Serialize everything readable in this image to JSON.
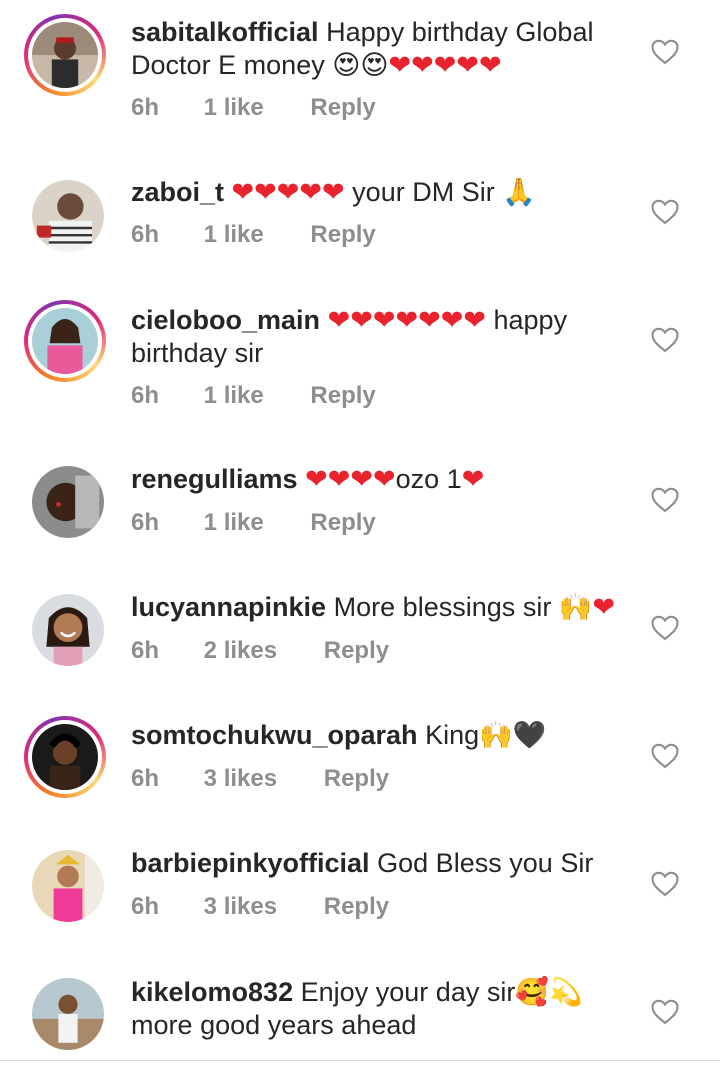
{
  "comments": [
    {
      "username": "sabitalkofficial",
      "text": " Happy birthday Global Doctor E money 😍😍❤️❤️❤️❤️❤️",
      "time": "6h",
      "likes": "1 like",
      "reply": "Reply",
      "has_story_ring": true
    },
    {
      "username": "zaboi_t",
      "text": " ❤️❤️❤️❤️❤️ your DM Sir 🙏",
      "time": "6h",
      "likes": "1 like",
      "reply": "Reply",
      "has_story_ring": false
    },
    {
      "username": "cieloboo_main",
      "text": " ❤️❤️❤️❤️❤️❤️❤️ happy birthday sir",
      "time": "6h",
      "likes": "1 like",
      "reply": "Reply",
      "has_story_ring": true
    },
    {
      "username": "renegulliams",
      "text": " ❤️❤️❤️❤️ozo 1❤️",
      "time": "6h",
      "likes": "1 like",
      "reply": "Reply",
      "has_story_ring": false
    },
    {
      "username": "lucyannapinkie",
      "text": " More blessings sir 🙌❤️",
      "time": "6h",
      "likes": "2 likes",
      "reply": "Reply",
      "has_story_ring": false
    },
    {
      "username": "somtochukwu_oparah",
      "text": " King🙌🖤",
      "time": "6h",
      "likes": "3 likes",
      "reply": "Reply",
      "has_story_ring": true
    },
    {
      "username": "barbiepinkyofficial",
      "text": " God Bless you Sir",
      "time": "6h",
      "likes": "3 likes",
      "reply": "Reply",
      "has_story_ring": false
    },
    {
      "username": "kikelomo832",
      "text": " Enjoy your day sir🥰💫 more good years ahead",
      "time": "",
      "likes": "",
      "reply": "",
      "has_story_ring": false
    }
  ],
  "icons": {
    "like": "heart-outline-icon",
    "avatar": "user-avatar"
  },
  "colors": {
    "text": "#262626",
    "meta": "#8e8e8e",
    "heart_outline": "#8e8e8e",
    "story_ring_start": "#f58529",
    "story_ring_end": "#dd2a7b"
  }
}
